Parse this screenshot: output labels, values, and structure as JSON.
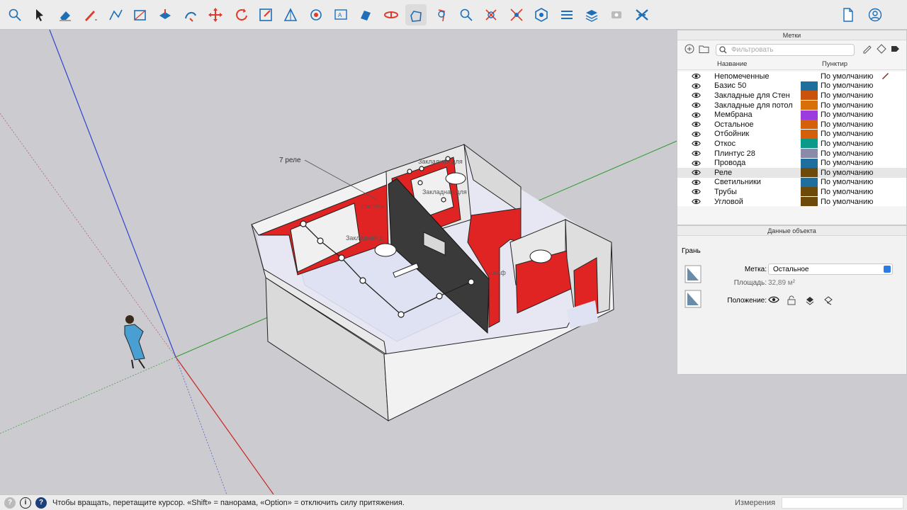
{
  "toolbar": {
    "tools": [
      "search-icon",
      "select-arrow-icon",
      "eraser-icon",
      "pencil-line-icon",
      "polyline-icon",
      "rectangle-icon",
      "push-pull-icon",
      "follow-me-icon",
      "move-icon",
      "rotate-icon",
      "scale-icon",
      "tape-measure-icon",
      "paint-bucket-icon",
      "text-icon",
      "section-plane-icon",
      "orbit-icon",
      "pan-icon",
      "walk-icon",
      "zoom-icon",
      "zoom-window-icon",
      "zoom-extents-icon",
      "components-icon",
      "styles-icon",
      "layers-icon",
      "scenes-icon",
      "extension-icon"
    ],
    "active_tool_index": 16,
    "right_icons": [
      "new-document-icon",
      "user-account-icon"
    ]
  },
  "viewport": {
    "annotations": {
      "relay_label": "7 реле",
      "embedded_label_1": "Закладная д",
      "embedded_label_2": "светиль",
      "embedded_label_3": "Закладная для",
      "embedded_label_4": "Закладная для",
      "embedded_label_5": "",
      "embedded_label_6": "шкаф",
      "embedded_label_7": "шкаф"
    }
  },
  "tags_panel": {
    "title": "Метки",
    "filter_placeholder": "Фильтровать",
    "col_name": "Название",
    "col_dash": "Пунктир",
    "rows": [
      {
        "name": "Непомеченные",
        "color": "",
        "dash": "По умолчанию",
        "selected": false,
        "active": true
      },
      {
        "name": "Базис 50",
        "color": "#1e6e9e",
        "dash": "По умолчанию",
        "selected": false,
        "active": false
      },
      {
        "name": "Закладные для Стен",
        "color": "#c9530c",
        "dash": "По умолчанию",
        "selected": false,
        "active": false
      },
      {
        "name": "Закладные для потол",
        "color": "#d7700b",
        "dash": "По умолчанию",
        "selected": false,
        "active": false
      },
      {
        "name": "Мембрана",
        "color": "#9b3dde",
        "dash": "По умолчанию",
        "selected": false,
        "active": false
      },
      {
        "name": "Остальное",
        "color": "#d4600a",
        "dash": "По умолчанию",
        "selected": false,
        "active": false
      },
      {
        "name": "Отбойник",
        "color": "#d4600a",
        "dash": "По умолчанию",
        "selected": false,
        "active": false
      },
      {
        "name": "Откос",
        "color": "#0b9a8a",
        "dash": "По умолчанию",
        "selected": false,
        "active": false
      },
      {
        "name": "Плинтус 28",
        "color": "#8b8aa8",
        "dash": "По умолчанию",
        "selected": false,
        "active": false
      },
      {
        "name": "Провода",
        "color": "#1e6e9e",
        "dash": "По умолчанию",
        "selected": false,
        "active": false
      },
      {
        "name": "Реле",
        "color": "#6e4a0a",
        "dash": "По умолчанию",
        "selected": true,
        "active": false
      },
      {
        "name": "Светильники",
        "color": "#1e6e9e",
        "dash": "По умолчанию",
        "selected": false,
        "active": false
      },
      {
        "name": "Трубы",
        "color": "#6e4a0a",
        "dash": "По умолчанию",
        "selected": false,
        "active": false
      },
      {
        "name": "Угловой",
        "color": "#6e4a0a",
        "dash": "По умолчанию",
        "selected": false,
        "active": false
      }
    ]
  },
  "info_panel": {
    "title": "Данные объекта",
    "entity_type": "Грань",
    "tag_label": "Метка:",
    "tag_value": "Остальное",
    "area_label": "Площадь:",
    "area_value": "32,89 м²",
    "position_label": "Положение:"
  },
  "statusbar": {
    "hint": "Чтобы вращать, перетащите курсор. «Shift» = панорама, «Option» = отключить силу притяжения.",
    "measurements_label": "Измерения",
    "measurements_value": ""
  }
}
